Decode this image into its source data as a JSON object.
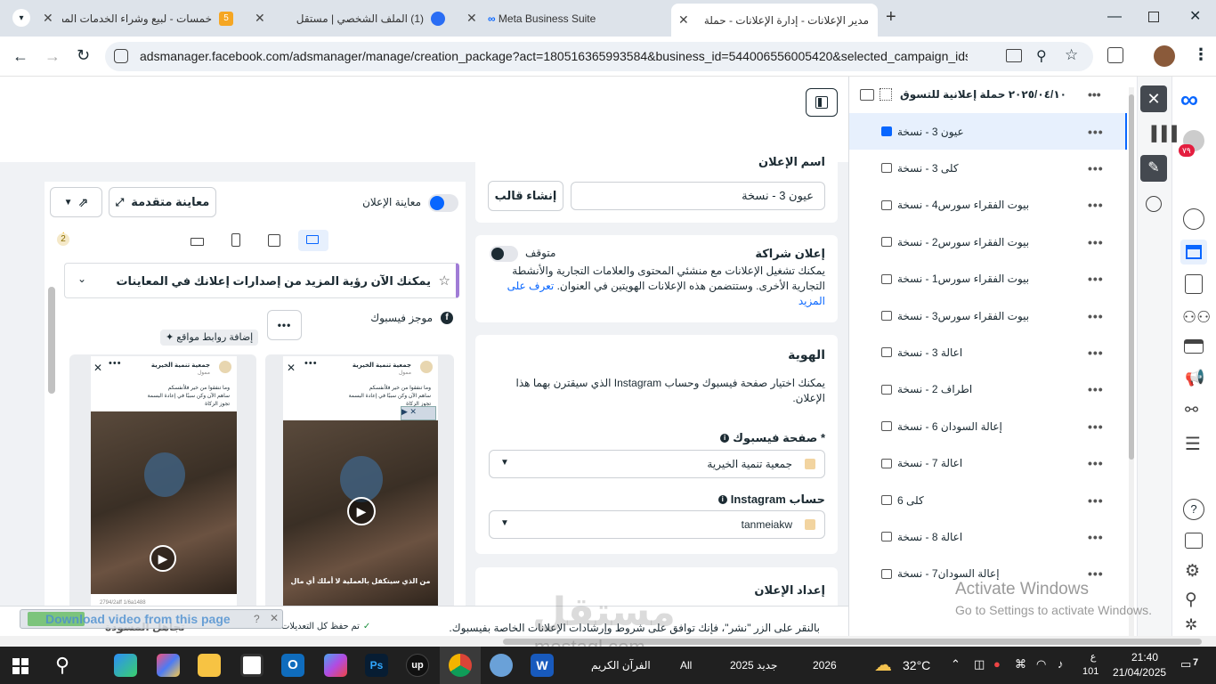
{
  "browser": {
    "tabs": [
      {
        "title": "خمسات - لبيع وشراء الخدمات المصغرة",
        "badge": "5"
      },
      {
        "title": "(1) الملف الشخصي | مستقل",
        "badge": "1"
      },
      {
        "title": "Meta Business Suite",
        "badge": ""
      },
      {
        "title": "مدير الإعلانات - إدارة الإعلانات - حملة",
        "badge": ""
      }
    ],
    "new_tab": "+",
    "url": "adsmanager.facebook.com/adsmanager/manage/creation_package?act=180516365993584&business_id=544006556005420&selected_campaign_ids=120..."
  },
  "tree": {
    "campaign": "٢٠٢٥/٠٤/١٠ حملة إعلانية للتسوق",
    "ads": [
      "عيون 3 - نسخة",
      "كلى 3 - نسخة",
      "بيوت الفقراء سورس4 - نسخة",
      "بيوت الفقراء سورس2 - نسخة",
      "بيوت الفقراء سورس1 - نسخة",
      "بيوت الفقراء سورس3 - نسخة",
      "اعالة 3 - نسخة",
      "اطراف 2 - نسخة",
      "إعالة السودان 6 - نسخة",
      "اعالة 7 - نسخة",
      "كلى 6",
      "اعالة 8 - نسخة",
      "إعالة السودان7 - نسخة"
    ],
    "more": "•••"
  },
  "editor": {
    "ad_name_label": "اسم الإعلان",
    "ad_name_value": "عيون 3 - نسخة",
    "create_template": "إنشاء قالب",
    "partnership_title": "إعلان شراكة",
    "partnership_status": "متوقف",
    "partnership_desc": "يمكنك تشغيل الإعلانات مع منشئي المحتوى والعلامات التجارية والأنشطة التجارية الأخرى. وستتضمن هذه الإعلانات الهويتين في العنوان.",
    "learn_more": "تعرف على المزيد",
    "identity_title": "الهوية",
    "identity_desc": "يمكنك اختيار صفحة فيسبوك وحساب Instagram الذي سيقترن بهما هذا الإعلان.",
    "fb_page_label": "* صفحة فيسبوك",
    "fb_page_value": "جمعية تنمية الخيرية",
    "ig_label": "حساب Instagram",
    "ig_value": "tanmeiakw",
    "setup_title": "إعداد الإعلان"
  },
  "preview": {
    "toggle_label": "معاينة الإعلان",
    "advanced_preview": "معاينة متقدمة",
    "warning_count": "2",
    "banner": "يمكنك الآن رؤية المزيد من إصدارات إعلانك في المعاينات",
    "placement": "موجز فيسبوك",
    "more": "•••",
    "add_links": "إضافة روابط مواقع",
    "page_name": "جمعية تنمية الخيرية",
    "sponsored": "ممول",
    "ad_text_1": "وما تنفقوا من خير فلأنفسكم",
    "ad_text_2": "ساهم الآن وكن سببًا في إعادة البسمة",
    "ad_text_3": "تجوز الزكاة",
    "video_caption": "من الذي سيتكفل بالعملية لا أملك أي مال",
    "footer_counts": "2794/2aff 1/6a1488"
  },
  "footer": {
    "terms": "بالنقر على الزر \"نشر\"، فإنك توافق على شروط وإرشادات الإعلانات الخاصة بفيسبوك.",
    "saved": "تم حفظ كل التعديلات",
    "discard": "تجاهل المسودة",
    "download_video": "Download video from this page"
  },
  "activate": {
    "title": "Activate Windows",
    "sub": "Go to Settings to activate Windows."
  },
  "watermark": {
    "ar": "مستقل",
    "en": "mostaql.com"
  },
  "taskbar": {
    "items": [
      "الفرآن الكريم",
      "All",
      "جديد 2025",
      "2026"
    ],
    "temp": "32°C",
    "lang": "ع",
    "time": "21:40",
    "date": "21/04/2025",
    "num": "101",
    "notif": "7"
  },
  "colors": {
    "meta_blue": "#0866ff",
    "accent": "#1877f2"
  }
}
